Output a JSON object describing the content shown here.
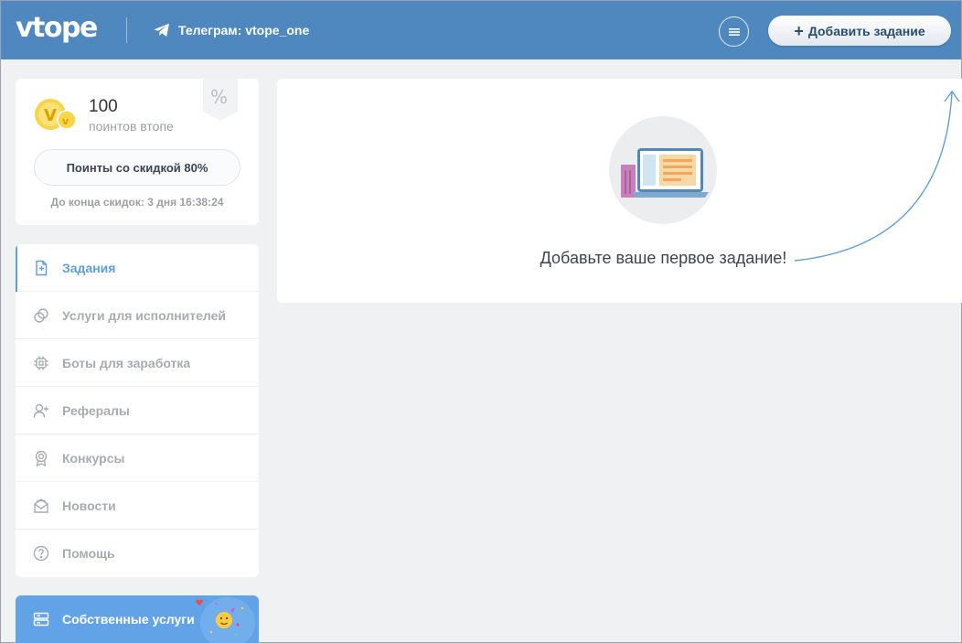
{
  "header": {
    "logo": "vtope",
    "telegram_label": "Телеграм: vtope_one",
    "add_task_label": "Добавить задание"
  },
  "points": {
    "value": "100",
    "label": "поинтов втопе",
    "discount_button": "Поинты со скидкой 80%",
    "timer": "До конца скидок: 3 дня 16:38:24",
    "discount_tag": "%"
  },
  "nav": {
    "items": [
      {
        "label": "Задания",
        "icon": "task-icon",
        "active": true
      },
      {
        "label": "Услуги для исполнителей",
        "icon": "services-icon",
        "active": false
      },
      {
        "label": "Боты для заработка",
        "icon": "chip-icon",
        "active": false
      },
      {
        "label": "Рефералы",
        "icon": "add-user-icon",
        "active": false
      },
      {
        "label": "Конкурсы",
        "icon": "award-icon",
        "active": false
      },
      {
        "label": "Новости",
        "icon": "mail-icon",
        "active": false
      },
      {
        "label": "Помощь",
        "icon": "help-icon",
        "active": false
      }
    ],
    "own_services": "Собственные услуги"
  },
  "main": {
    "empty_message": "Добавьте ваше первое задание!"
  },
  "colors": {
    "header": "#4e88bf",
    "accent": "#5b9ee1",
    "own_services_bg": "#62a3e8"
  }
}
